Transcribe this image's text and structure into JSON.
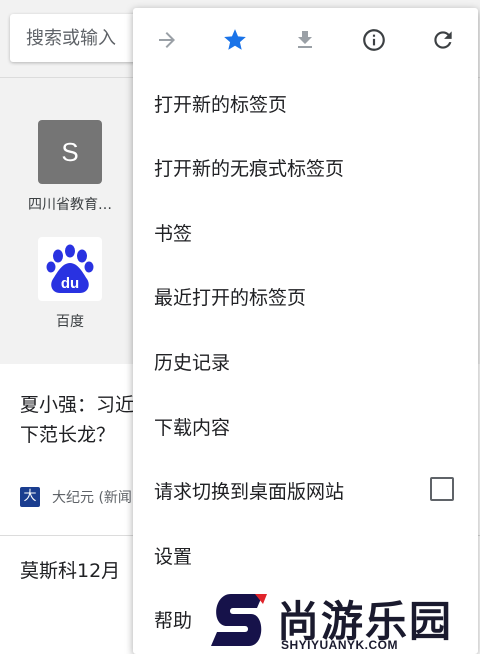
{
  "search": {
    "placeholder": "搜索或输入"
  },
  "tiles": [
    {
      "letter": "S",
      "label": "四川省教育…"
    },
    {
      "icon": "baidu-paw-icon",
      "logo_text": "du",
      "label": "百度"
    }
  ],
  "news": [
    {
      "title": "夏小强：习近\n下范长龙？",
      "source": "大纪元 (新闻"
    },
    {
      "title": "莫斯科12月"
    }
  ],
  "menu": {
    "toolbar": [
      "forward-arrow-icon",
      "star-icon",
      "download-icon",
      "info-icon",
      "reload-icon"
    ],
    "accent_color": "#1a73e8",
    "items": [
      {
        "label": "打开新的标签页"
      },
      {
        "label": "打开新的无痕式标签页"
      },
      {
        "label": "书签"
      },
      {
        "label": "最近打开的标签页"
      },
      {
        "label": "历史记录"
      },
      {
        "label": "下载内容"
      },
      {
        "label": "请求切换到桌面版网站",
        "checkbox": false
      },
      {
        "label": "设置"
      },
      {
        "label": "帮助"
      }
    ]
  },
  "watermark": {
    "text": "尚游乐园",
    "url": "SHYIYUANYK.COM"
  }
}
